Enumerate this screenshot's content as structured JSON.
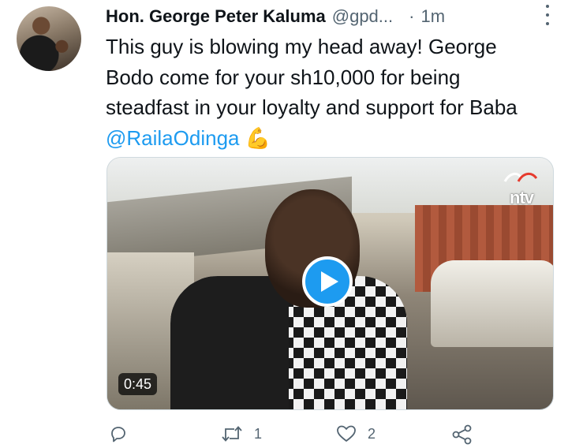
{
  "tweet": {
    "author_name": "Hon. George Peter Kaluma",
    "handle": "@gpd...",
    "separator": "·",
    "time": "1m",
    "text_before_mention": "This guy is blowing my head away! George Bodo come for your sh10,000 for being steadfast in your loyalty and support for Baba ",
    "mention": "@RailaOdinga",
    "emoji": "💪"
  },
  "media": {
    "duration": "0:45",
    "channel_logo_text": "ntv"
  },
  "actions": {
    "reply_count": "",
    "retweet_count": "1",
    "like_count": "2"
  },
  "icons": {
    "more": "more-vertical-icon",
    "reply": "reply-icon",
    "retweet": "retweet-icon",
    "like": "heart-icon",
    "share": "share-icon",
    "play": "play-icon"
  },
  "colors": {
    "link": "#1d9bf0",
    "secondary_text": "#536471",
    "primary_text": "#0f1419"
  }
}
